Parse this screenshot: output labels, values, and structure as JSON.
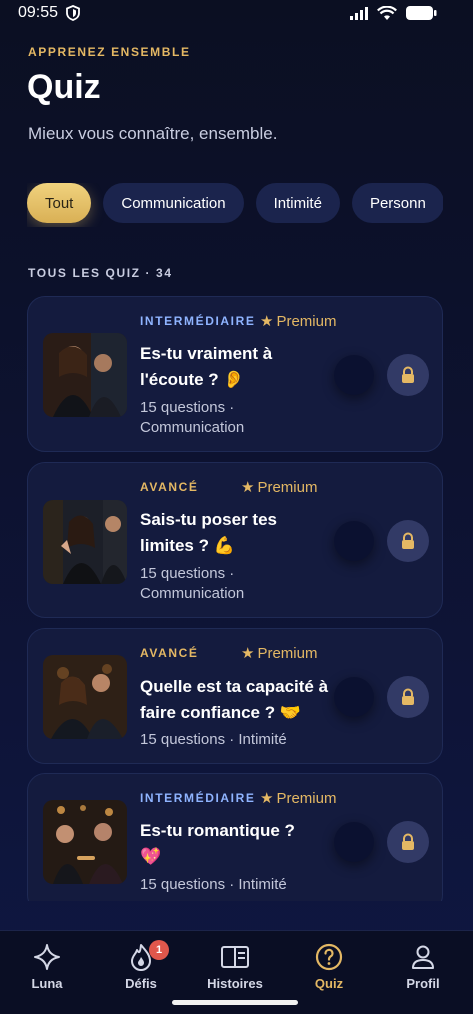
{
  "status": {
    "time": "09:55"
  },
  "header": {
    "eyebrow": "APPRENEZ ENSEMBLE",
    "title": "Quiz",
    "subtitle": "Mieux vous connaître, ensemble."
  },
  "filters": [
    {
      "label": "Tout",
      "active": true
    },
    {
      "label": "Communication",
      "active": false
    },
    {
      "label": "Intimité",
      "active": false
    },
    {
      "label": "Personn",
      "active": false
    }
  ],
  "section": {
    "label": "TOUS LES QUIZ · 34"
  },
  "quizzes": [
    {
      "level": "INTERMÉDIAIRE",
      "level_color": "#8fb4ff",
      "premium": "Premium",
      "title": "Es-tu vraiment à l'écoute ? 👂",
      "meta": "15 questions · Communication"
    },
    {
      "level": "AVANCÉ",
      "level_color": "#e4b864",
      "premium": "Premium",
      "title": "Sais-tu poser tes limites ? 💪",
      "meta": "15 questions · Communication"
    },
    {
      "level": "AVANCÉ",
      "level_color": "#e4b864",
      "premium": "Premium",
      "title": "Quelle est ta capacité à faire confiance ? 🤝",
      "meta": "15 questions · Intimité"
    },
    {
      "level": "INTERMÉDIAIRE",
      "level_color": "#8fb4ff",
      "premium": "Premium",
      "title": "Es-tu romantique ? 💖",
      "meta": "15 questions · Intimité"
    }
  ],
  "tabbar": {
    "tabs": [
      {
        "label": "Luna",
        "icon": "sparkle-icon"
      },
      {
        "label": "Défis",
        "icon": "flame-icon",
        "badge": "1"
      },
      {
        "label": "Histoires",
        "icon": "book-icon"
      },
      {
        "label": "Quiz",
        "icon": "question-circle-icon",
        "active": true
      },
      {
        "label": "Profil",
        "icon": "person-icon"
      }
    ]
  },
  "colors": {
    "accent": "#e4b864",
    "background": "#0d1230",
    "card": "#141b3e",
    "chip": "#1b244d"
  }
}
